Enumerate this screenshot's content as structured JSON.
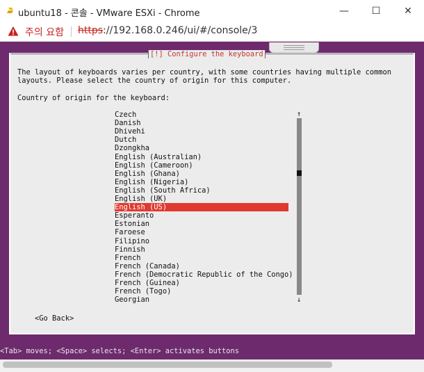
{
  "window": {
    "title": "ubuntu18 - 콘솔 - VMware ESXi - Chrome",
    "minimize_glyph": "—",
    "maximize_glyph": "☐",
    "close_glyph": "✕"
  },
  "addressbar": {
    "warning_text": "주의 요함",
    "url_scheme": "https",
    "url_rest": "://192.168.0.246/ui/#/console/3"
  },
  "installer": {
    "dialog_title": "[!] Configure the keyboard",
    "description_line1": "The layout of keyboards varies per country, with some countries having multiple common",
    "description_line2": "layouts. Please select the country of origin for this computer.",
    "prompt": "Country of origin for the keyboard:",
    "countries": [
      "Czech",
      "Danish",
      "Dhivehi",
      "Dutch",
      "Dzongkha",
      "English (Australian)",
      "English (Cameroon)",
      "English (Ghana)",
      "English (Nigeria)",
      "English (South Africa)",
      "English (UK)",
      "English (US)",
      "Esperanto",
      "Estonian",
      "Faroese",
      "Filipino",
      "Finnish",
      "French",
      "French (Canada)",
      "French (Democratic Republic of the Congo)",
      "French (Guinea)",
      "French (Togo)",
      "Georgian"
    ],
    "selected_country": "English (US)",
    "scroll_up_glyph": "↑",
    "scroll_down_glyph": "↓",
    "go_back_label": "<Go Back>",
    "status_line": "<Tab> moves; <Space> selects; <Enter> activates buttons"
  },
  "colors": {
    "console_bg": "#6d2a6d",
    "dialog_bg": "#ececec",
    "selection_bg": "#e03a2f",
    "warning_red": "#c5221f"
  }
}
